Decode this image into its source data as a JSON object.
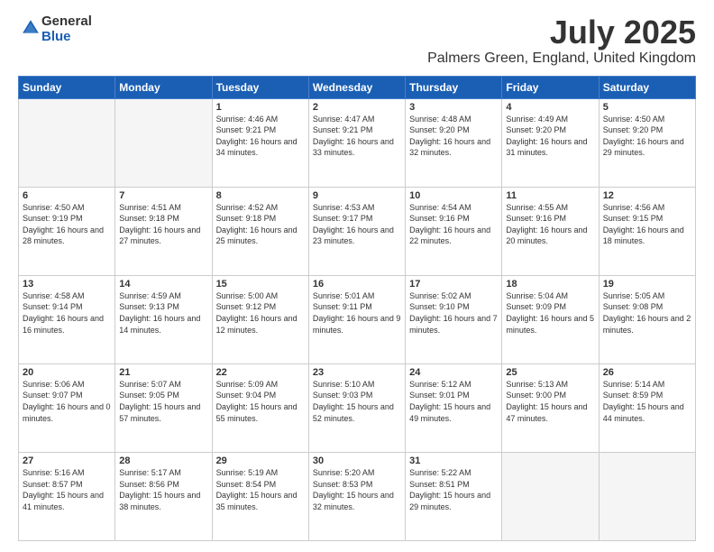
{
  "logo": {
    "general": "General",
    "blue": "Blue"
  },
  "title": "July 2025",
  "subtitle": "Palmers Green, England, United Kingdom",
  "days_header": [
    "Sunday",
    "Monday",
    "Tuesday",
    "Wednesday",
    "Thursday",
    "Friday",
    "Saturday"
  ],
  "weeks": [
    [
      {
        "day": "",
        "info": ""
      },
      {
        "day": "",
        "info": ""
      },
      {
        "day": "1",
        "info": "Sunrise: 4:46 AM\nSunset: 9:21 PM\nDaylight: 16 hours and 34 minutes."
      },
      {
        "day": "2",
        "info": "Sunrise: 4:47 AM\nSunset: 9:21 PM\nDaylight: 16 hours and 33 minutes."
      },
      {
        "day": "3",
        "info": "Sunrise: 4:48 AM\nSunset: 9:20 PM\nDaylight: 16 hours and 32 minutes."
      },
      {
        "day": "4",
        "info": "Sunrise: 4:49 AM\nSunset: 9:20 PM\nDaylight: 16 hours and 31 minutes."
      },
      {
        "day": "5",
        "info": "Sunrise: 4:50 AM\nSunset: 9:20 PM\nDaylight: 16 hours and 29 minutes."
      }
    ],
    [
      {
        "day": "6",
        "info": "Sunrise: 4:50 AM\nSunset: 9:19 PM\nDaylight: 16 hours and 28 minutes."
      },
      {
        "day": "7",
        "info": "Sunrise: 4:51 AM\nSunset: 9:18 PM\nDaylight: 16 hours and 27 minutes."
      },
      {
        "day": "8",
        "info": "Sunrise: 4:52 AM\nSunset: 9:18 PM\nDaylight: 16 hours and 25 minutes."
      },
      {
        "day": "9",
        "info": "Sunrise: 4:53 AM\nSunset: 9:17 PM\nDaylight: 16 hours and 23 minutes."
      },
      {
        "day": "10",
        "info": "Sunrise: 4:54 AM\nSunset: 9:16 PM\nDaylight: 16 hours and 22 minutes."
      },
      {
        "day": "11",
        "info": "Sunrise: 4:55 AM\nSunset: 9:16 PM\nDaylight: 16 hours and 20 minutes."
      },
      {
        "day": "12",
        "info": "Sunrise: 4:56 AM\nSunset: 9:15 PM\nDaylight: 16 hours and 18 minutes."
      }
    ],
    [
      {
        "day": "13",
        "info": "Sunrise: 4:58 AM\nSunset: 9:14 PM\nDaylight: 16 hours and 16 minutes."
      },
      {
        "day": "14",
        "info": "Sunrise: 4:59 AM\nSunset: 9:13 PM\nDaylight: 16 hours and 14 minutes."
      },
      {
        "day": "15",
        "info": "Sunrise: 5:00 AM\nSunset: 9:12 PM\nDaylight: 16 hours and 12 minutes."
      },
      {
        "day": "16",
        "info": "Sunrise: 5:01 AM\nSunset: 9:11 PM\nDaylight: 16 hours and 9 minutes."
      },
      {
        "day": "17",
        "info": "Sunrise: 5:02 AM\nSunset: 9:10 PM\nDaylight: 16 hours and 7 minutes."
      },
      {
        "day": "18",
        "info": "Sunrise: 5:04 AM\nSunset: 9:09 PM\nDaylight: 16 hours and 5 minutes."
      },
      {
        "day": "19",
        "info": "Sunrise: 5:05 AM\nSunset: 9:08 PM\nDaylight: 16 hours and 2 minutes."
      }
    ],
    [
      {
        "day": "20",
        "info": "Sunrise: 5:06 AM\nSunset: 9:07 PM\nDaylight: 16 hours and 0 minutes."
      },
      {
        "day": "21",
        "info": "Sunrise: 5:07 AM\nSunset: 9:05 PM\nDaylight: 15 hours and 57 minutes."
      },
      {
        "day": "22",
        "info": "Sunrise: 5:09 AM\nSunset: 9:04 PM\nDaylight: 15 hours and 55 minutes."
      },
      {
        "day": "23",
        "info": "Sunrise: 5:10 AM\nSunset: 9:03 PM\nDaylight: 15 hours and 52 minutes."
      },
      {
        "day": "24",
        "info": "Sunrise: 5:12 AM\nSunset: 9:01 PM\nDaylight: 15 hours and 49 minutes."
      },
      {
        "day": "25",
        "info": "Sunrise: 5:13 AM\nSunset: 9:00 PM\nDaylight: 15 hours and 47 minutes."
      },
      {
        "day": "26",
        "info": "Sunrise: 5:14 AM\nSunset: 8:59 PM\nDaylight: 15 hours and 44 minutes."
      }
    ],
    [
      {
        "day": "27",
        "info": "Sunrise: 5:16 AM\nSunset: 8:57 PM\nDaylight: 15 hours and 41 minutes."
      },
      {
        "day": "28",
        "info": "Sunrise: 5:17 AM\nSunset: 8:56 PM\nDaylight: 15 hours and 38 minutes."
      },
      {
        "day": "29",
        "info": "Sunrise: 5:19 AM\nSunset: 8:54 PM\nDaylight: 15 hours and 35 minutes."
      },
      {
        "day": "30",
        "info": "Sunrise: 5:20 AM\nSunset: 8:53 PM\nDaylight: 15 hours and 32 minutes."
      },
      {
        "day": "31",
        "info": "Sunrise: 5:22 AM\nSunset: 8:51 PM\nDaylight: 15 hours and 29 minutes."
      },
      {
        "day": "",
        "info": ""
      },
      {
        "day": "",
        "info": ""
      }
    ]
  ]
}
